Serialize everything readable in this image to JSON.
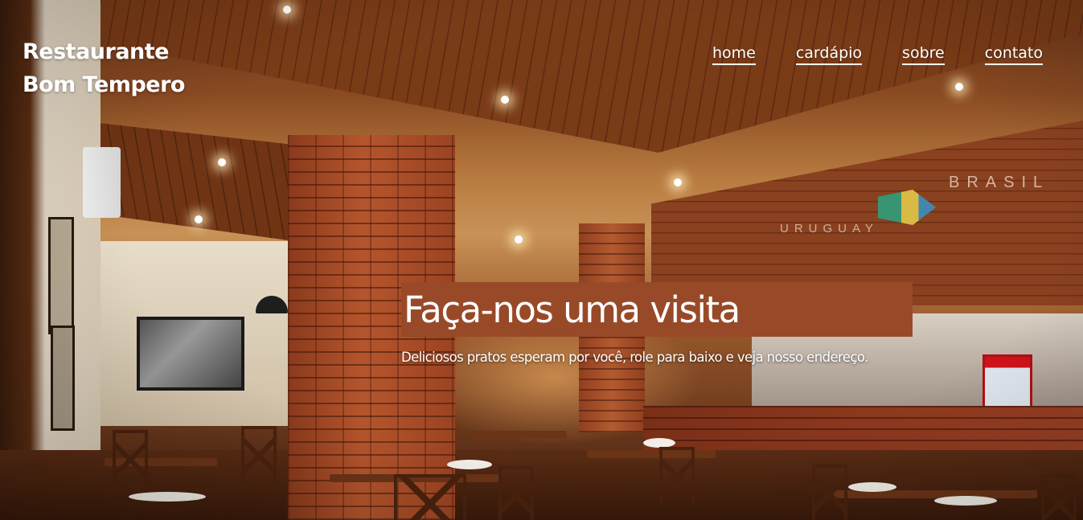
{
  "brand": {
    "line1": "Restaurante",
    "line2": "Bom Tempero"
  },
  "nav": {
    "items": [
      {
        "label": "home"
      },
      {
        "label": "cardápio"
      },
      {
        "label": "sobre"
      },
      {
        "label": "contato"
      }
    ]
  },
  "hero": {
    "title": "Faça-nos uma visita",
    "subtitle": "Deliciosos pratos esperam por você, role para baixo e veja nosso endereço.",
    "background_signage": {
      "brasil": "BRASIL",
      "uruguay": "URUGUAY"
    }
  },
  "colors": {
    "title_box": "#984a28",
    "text": "#ffffff"
  }
}
